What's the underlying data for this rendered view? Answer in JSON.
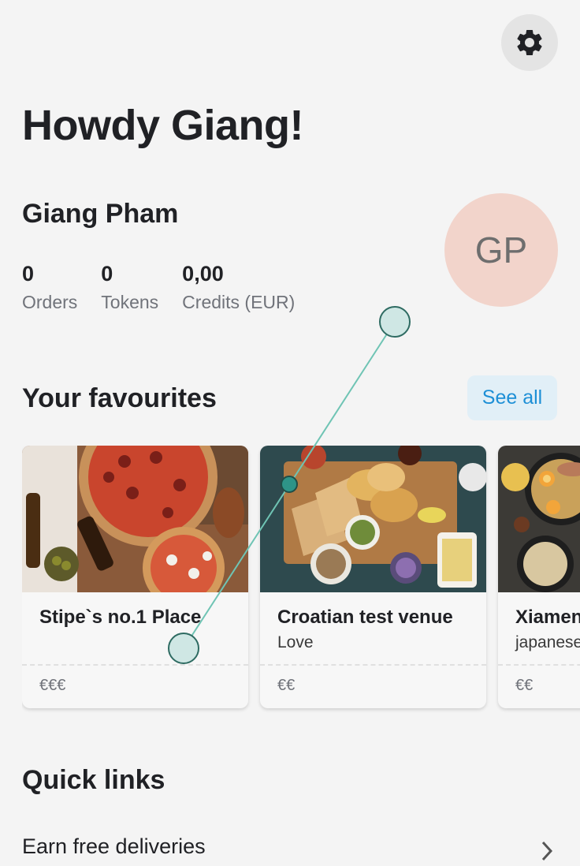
{
  "header": {
    "settings_icon": "gear-icon",
    "greeting": "Howdy Giang!"
  },
  "profile": {
    "name": "Giang Pham",
    "initials": "GP",
    "avatar_color": "#f2d4cb",
    "stats": [
      {
        "value": "0",
        "label": "Orders"
      },
      {
        "value": "0",
        "label": "Tokens"
      },
      {
        "value": "0,00",
        "label": "Credits (EUR)"
      }
    ]
  },
  "favourites": {
    "title": "Your favourites",
    "see_all_label": "See all",
    "venues": [
      {
        "name": "Stipe`s no.1 Place",
        "subtitle": "",
        "price": "€€€"
      },
      {
        "name": "Croatian test venue",
        "subtitle": "Love",
        "price": "€€"
      },
      {
        "name": "Xiamen",
        "subtitle": "japanese",
        "price": "€€"
      }
    ]
  },
  "quick_links": {
    "title": "Quick links",
    "items": [
      {
        "label": "Earn free deliveries",
        "icon": "chevron-right-icon"
      }
    ]
  },
  "colors": {
    "accent": "#1d8fd6",
    "see_all_bg": "#e1eff7",
    "background": "#f4f4f4"
  }
}
